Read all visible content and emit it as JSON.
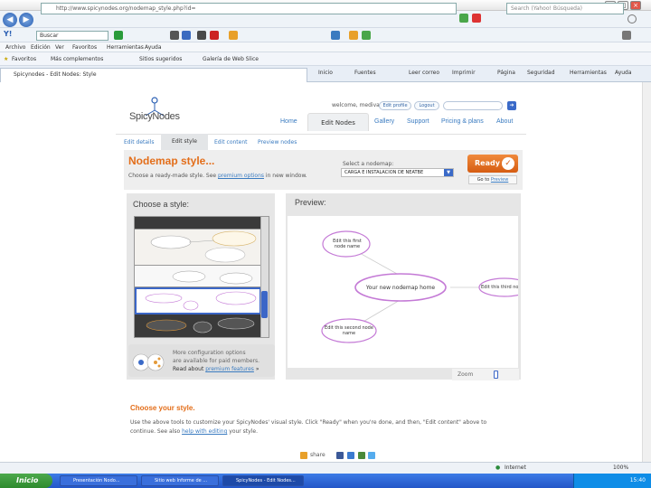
{
  "browser": {
    "address_url": "http://www.spicynodes.org/nodemap_style.php?id=",
    "search_placeholder": "Search (Yahoo! Búsqueda)",
    "toolbar_search_value": "Buscar",
    "menu": [
      "Archivo",
      "Edición",
      "Ver",
      "Favoritos",
      "Herramientas",
      "Ayuda"
    ],
    "favorites_label": "Favoritos",
    "fav_links": [
      "Más complementos",
      "Sitios sugeridos",
      "Galería de Web Slice"
    ],
    "tab_title": "Spicynodes - Edit Nodes: Style",
    "cmd_items": [
      "Inicio",
      "Fuentes",
      "Leer correo",
      "Imprimir",
      "Página",
      "Seguridad",
      "Herramientas",
      "Ayuda"
    ]
  },
  "site": {
    "logo": "SpicyNodes",
    "welcome": "welcome, medivary",
    "edit_profile": "Edit profile",
    "logout": "Logout",
    "nav": [
      "Home",
      "Edit Nodes",
      "Gallery",
      "Support",
      "Pricing & plans",
      "About"
    ],
    "subnav": [
      "Edit details",
      "Edit style",
      "Edit content",
      "Preview nodes"
    ],
    "heading": "Nodemap style...",
    "intro_pre": "Choose a ready-made style. See ",
    "intro_link": "premium options",
    "intro_post": " in new window.",
    "select_label": "Select a nodemap:",
    "select_value": "CARGA E INSTALACION DE NEATBE",
    "ready": "Ready",
    "goto_pre": "Go to ",
    "goto_link": "Preview",
    "choose_style": "Choose a style:",
    "preview_title": "Preview:",
    "zoom": "Zoom",
    "promo_line1": "More configuration options",
    "promo_line2": "are available for paid members.",
    "promo_line3_pre": "Read about ",
    "promo_line3_link": "premium features",
    "promo_line3_post": " »",
    "preview_nodes": {
      "center": "Your new nodemap home",
      "top": "Edit this first node name",
      "bottom": "Edit this second node name",
      "right": "Edit this third node name"
    },
    "choose_your_style": "Choose your style.",
    "bottom_line1": "Use the above tools to customize your SpicyNodes' visual style. Click \"Ready\" when you're done, and then, \"Edit content\" above to",
    "bottom_line2_pre": "continue. See also ",
    "bottom_line2_link": "help with editing",
    "bottom_line2_post": " your style.",
    "share": "share"
  },
  "status": {
    "zone": "Internet",
    "zoom": "100%"
  },
  "taskbar": {
    "start": "Inicio",
    "tasks": [
      "Presentación Nodo...",
      "Sitio web Informe de ...",
      "SpicyNodes - Edit Nodes..."
    ],
    "clock": "15:40"
  },
  "colors": {
    "accent": "#e36e1a",
    "link": "#3a7bc0",
    "node_border": "#c47ad6"
  }
}
